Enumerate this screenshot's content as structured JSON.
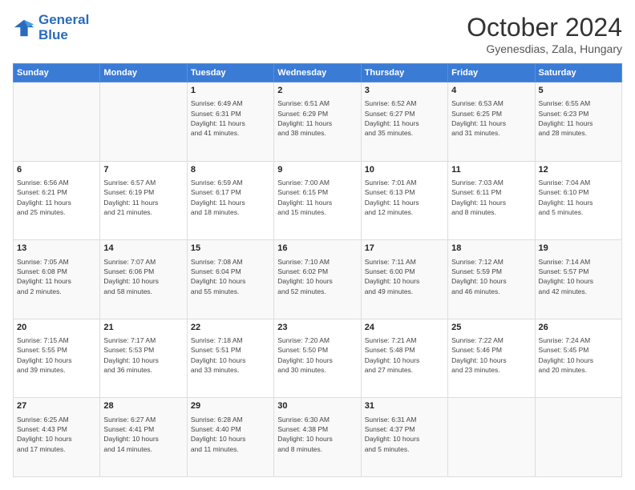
{
  "logo": {
    "line1": "General",
    "line2": "Blue"
  },
  "header": {
    "month": "October 2024",
    "location": "Gyenesdias, Zala, Hungary"
  },
  "columns": [
    "Sunday",
    "Monday",
    "Tuesday",
    "Wednesday",
    "Thursday",
    "Friday",
    "Saturday"
  ],
  "rows": [
    [
      {
        "day": "",
        "lines": []
      },
      {
        "day": "",
        "lines": []
      },
      {
        "day": "1",
        "lines": [
          "Sunrise: 6:49 AM",
          "Sunset: 6:31 PM",
          "Daylight: 11 hours",
          "and 41 minutes."
        ]
      },
      {
        "day": "2",
        "lines": [
          "Sunrise: 6:51 AM",
          "Sunset: 6:29 PM",
          "Daylight: 11 hours",
          "and 38 minutes."
        ]
      },
      {
        "day": "3",
        "lines": [
          "Sunrise: 6:52 AM",
          "Sunset: 6:27 PM",
          "Daylight: 11 hours",
          "and 35 minutes."
        ]
      },
      {
        "day": "4",
        "lines": [
          "Sunrise: 6:53 AM",
          "Sunset: 6:25 PM",
          "Daylight: 11 hours",
          "and 31 minutes."
        ]
      },
      {
        "day": "5",
        "lines": [
          "Sunrise: 6:55 AM",
          "Sunset: 6:23 PM",
          "Daylight: 11 hours",
          "and 28 minutes."
        ]
      }
    ],
    [
      {
        "day": "6",
        "lines": [
          "Sunrise: 6:56 AM",
          "Sunset: 6:21 PM",
          "Daylight: 11 hours",
          "and 25 minutes."
        ]
      },
      {
        "day": "7",
        "lines": [
          "Sunrise: 6:57 AM",
          "Sunset: 6:19 PM",
          "Daylight: 11 hours",
          "and 21 minutes."
        ]
      },
      {
        "day": "8",
        "lines": [
          "Sunrise: 6:59 AM",
          "Sunset: 6:17 PM",
          "Daylight: 11 hours",
          "and 18 minutes."
        ]
      },
      {
        "day": "9",
        "lines": [
          "Sunrise: 7:00 AM",
          "Sunset: 6:15 PM",
          "Daylight: 11 hours",
          "and 15 minutes."
        ]
      },
      {
        "day": "10",
        "lines": [
          "Sunrise: 7:01 AM",
          "Sunset: 6:13 PM",
          "Daylight: 11 hours",
          "and 12 minutes."
        ]
      },
      {
        "day": "11",
        "lines": [
          "Sunrise: 7:03 AM",
          "Sunset: 6:11 PM",
          "Daylight: 11 hours",
          "and 8 minutes."
        ]
      },
      {
        "day": "12",
        "lines": [
          "Sunrise: 7:04 AM",
          "Sunset: 6:10 PM",
          "Daylight: 11 hours",
          "and 5 minutes."
        ]
      }
    ],
    [
      {
        "day": "13",
        "lines": [
          "Sunrise: 7:05 AM",
          "Sunset: 6:08 PM",
          "Daylight: 11 hours",
          "and 2 minutes."
        ]
      },
      {
        "day": "14",
        "lines": [
          "Sunrise: 7:07 AM",
          "Sunset: 6:06 PM",
          "Daylight: 10 hours",
          "and 58 minutes."
        ]
      },
      {
        "day": "15",
        "lines": [
          "Sunrise: 7:08 AM",
          "Sunset: 6:04 PM",
          "Daylight: 10 hours",
          "and 55 minutes."
        ]
      },
      {
        "day": "16",
        "lines": [
          "Sunrise: 7:10 AM",
          "Sunset: 6:02 PM",
          "Daylight: 10 hours",
          "and 52 minutes."
        ]
      },
      {
        "day": "17",
        "lines": [
          "Sunrise: 7:11 AM",
          "Sunset: 6:00 PM",
          "Daylight: 10 hours",
          "and 49 minutes."
        ]
      },
      {
        "day": "18",
        "lines": [
          "Sunrise: 7:12 AM",
          "Sunset: 5:59 PM",
          "Daylight: 10 hours",
          "and 46 minutes."
        ]
      },
      {
        "day": "19",
        "lines": [
          "Sunrise: 7:14 AM",
          "Sunset: 5:57 PM",
          "Daylight: 10 hours",
          "and 42 minutes."
        ]
      }
    ],
    [
      {
        "day": "20",
        "lines": [
          "Sunrise: 7:15 AM",
          "Sunset: 5:55 PM",
          "Daylight: 10 hours",
          "and 39 minutes."
        ]
      },
      {
        "day": "21",
        "lines": [
          "Sunrise: 7:17 AM",
          "Sunset: 5:53 PM",
          "Daylight: 10 hours",
          "and 36 minutes."
        ]
      },
      {
        "day": "22",
        "lines": [
          "Sunrise: 7:18 AM",
          "Sunset: 5:51 PM",
          "Daylight: 10 hours",
          "and 33 minutes."
        ]
      },
      {
        "day": "23",
        "lines": [
          "Sunrise: 7:20 AM",
          "Sunset: 5:50 PM",
          "Daylight: 10 hours",
          "and 30 minutes."
        ]
      },
      {
        "day": "24",
        "lines": [
          "Sunrise: 7:21 AM",
          "Sunset: 5:48 PM",
          "Daylight: 10 hours",
          "and 27 minutes."
        ]
      },
      {
        "day": "25",
        "lines": [
          "Sunrise: 7:22 AM",
          "Sunset: 5:46 PM",
          "Daylight: 10 hours",
          "and 23 minutes."
        ]
      },
      {
        "day": "26",
        "lines": [
          "Sunrise: 7:24 AM",
          "Sunset: 5:45 PM",
          "Daylight: 10 hours",
          "and 20 minutes."
        ]
      }
    ],
    [
      {
        "day": "27",
        "lines": [
          "Sunrise: 6:25 AM",
          "Sunset: 4:43 PM",
          "Daylight: 10 hours",
          "and 17 minutes."
        ]
      },
      {
        "day": "28",
        "lines": [
          "Sunrise: 6:27 AM",
          "Sunset: 4:41 PM",
          "Daylight: 10 hours",
          "and 14 minutes."
        ]
      },
      {
        "day": "29",
        "lines": [
          "Sunrise: 6:28 AM",
          "Sunset: 4:40 PM",
          "Daylight: 10 hours",
          "and 11 minutes."
        ]
      },
      {
        "day": "30",
        "lines": [
          "Sunrise: 6:30 AM",
          "Sunset: 4:38 PM",
          "Daylight: 10 hours",
          "and 8 minutes."
        ]
      },
      {
        "day": "31",
        "lines": [
          "Sunrise: 6:31 AM",
          "Sunset: 4:37 PM",
          "Daylight: 10 hours",
          "and 5 minutes."
        ]
      },
      {
        "day": "",
        "lines": []
      },
      {
        "day": "",
        "lines": []
      }
    ]
  ]
}
